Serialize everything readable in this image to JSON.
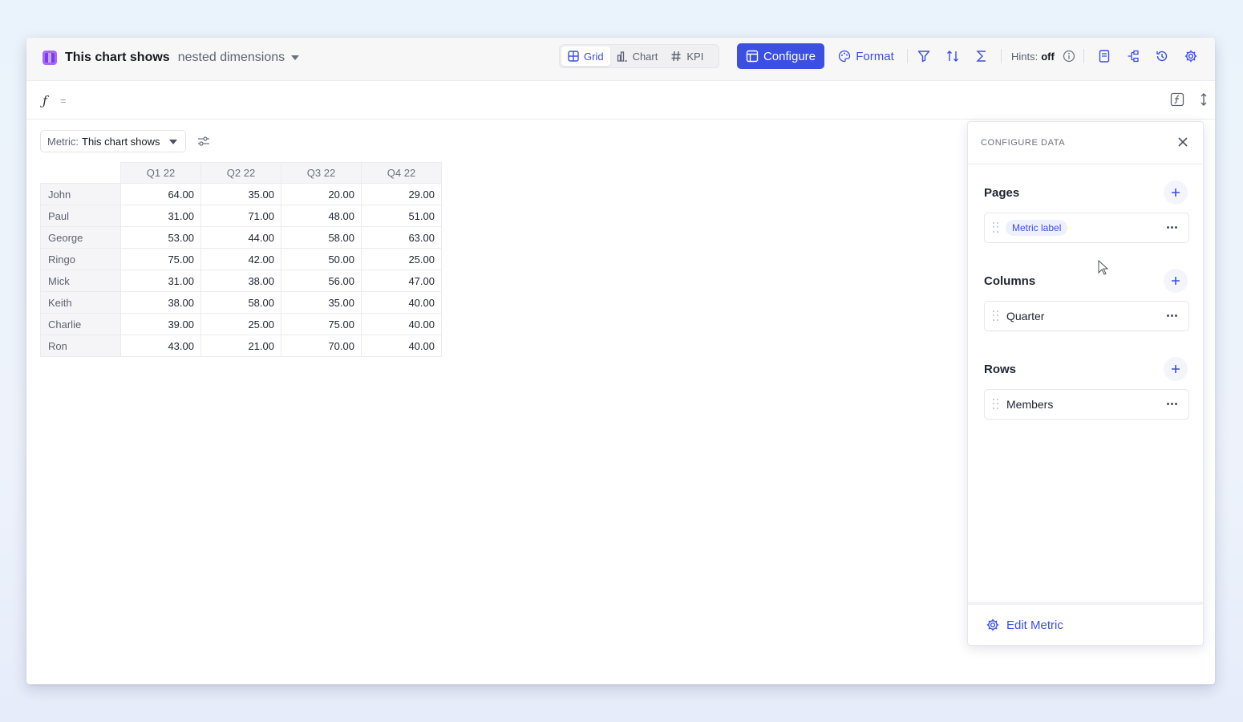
{
  "header": {
    "title": "This chart shows",
    "subtitle": "nested dimensions",
    "views": [
      {
        "label": "Grid",
        "active": true
      },
      {
        "label": "Chart",
        "active": false
      },
      {
        "label": "KPI",
        "active": false
      }
    ],
    "configure_label": "Configure",
    "format_label": "Format",
    "hints_label": "Hints:",
    "hints_value": "off"
  },
  "formula": {
    "symbol": "ƒ",
    "equals": "="
  },
  "metric": {
    "label": "Metric:",
    "value": "This chart shows"
  },
  "grid": {
    "columns": [
      "Q1 22",
      "Q2 22",
      "Q3 22",
      "Q4 22"
    ],
    "rows": [
      {
        "label": "John",
        "values": [
          "64.00",
          "35.00",
          "20.00",
          "29.00"
        ]
      },
      {
        "label": "Paul",
        "values": [
          "31.00",
          "71.00",
          "48.00",
          "51.00"
        ]
      },
      {
        "label": "George",
        "values": [
          "53.00",
          "44.00",
          "58.00",
          "63.00"
        ]
      },
      {
        "label": "Ringo",
        "values": [
          "75.00",
          "42.00",
          "50.00",
          "25.00"
        ]
      },
      {
        "label": "Mick",
        "values": [
          "31.00",
          "38.00",
          "56.00",
          "47.00"
        ]
      },
      {
        "label": "Keith",
        "values": [
          "38.00",
          "58.00",
          "35.00",
          "40.00"
        ]
      },
      {
        "label": "Charlie",
        "values": [
          "39.00",
          "25.00",
          "75.00",
          "40.00"
        ]
      },
      {
        "label": "Ron",
        "values": [
          "43.00",
          "21.00",
          "70.00",
          "40.00"
        ]
      }
    ]
  },
  "panel": {
    "title": "CONFIGURE DATA",
    "pages": {
      "title": "Pages",
      "item": "Metric label"
    },
    "columns": {
      "title": "Columns",
      "item": "Quarter"
    },
    "rows": {
      "title": "Rows",
      "item": "Members"
    },
    "edit_label": "Edit Metric"
  },
  "colors": {
    "accent": "#3b4fe0",
    "app_icon": "#a668f6"
  }
}
